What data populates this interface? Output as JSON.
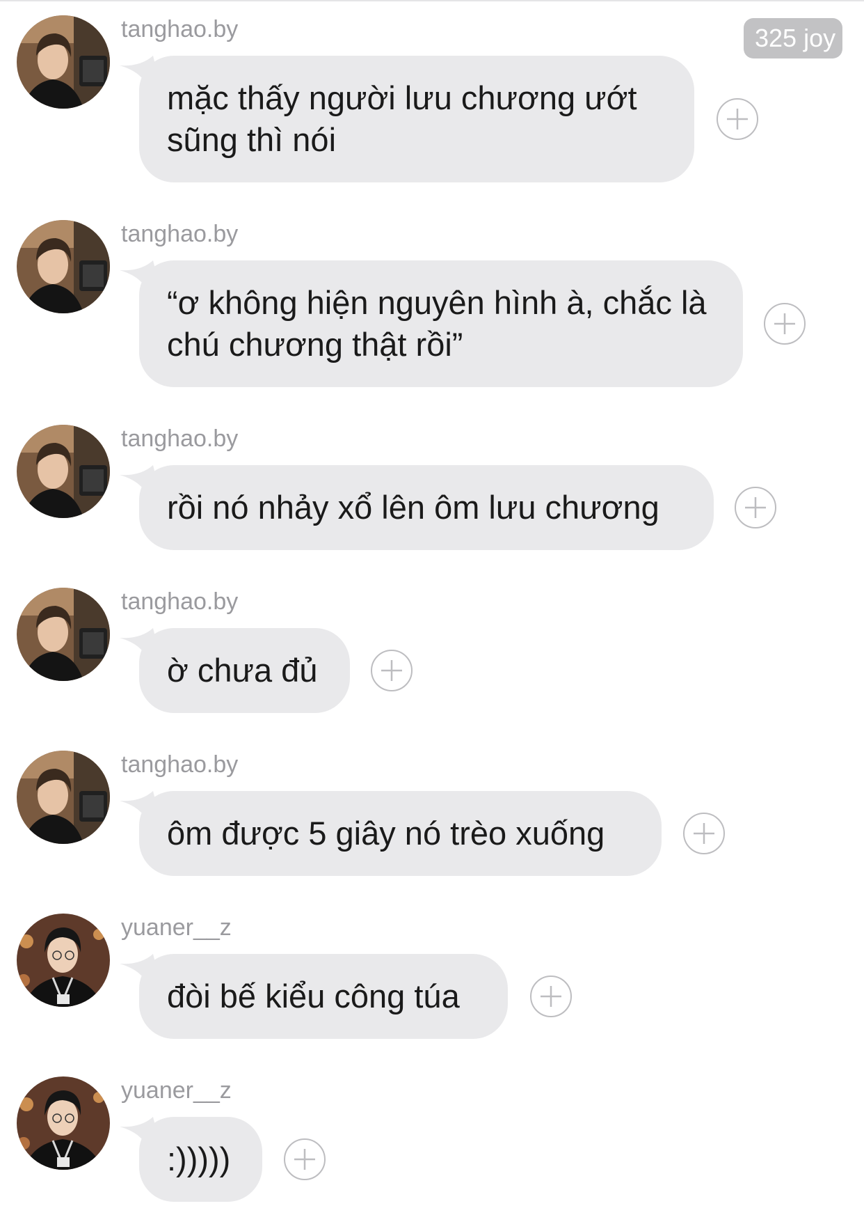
{
  "header": {
    "count_label": "325 joy"
  },
  "messages": [
    {
      "user": "tanghao.by",
      "avatar": "avatar-tanghao",
      "text": "mặc thấy người lưu chương ướt sũng thì nói"
    },
    {
      "user": "tanghao.by",
      "avatar": "avatar-tanghao",
      "text": "“ơ không hiện nguyên hình à, chắc là chú chương thật rồi”"
    },
    {
      "user": "tanghao.by",
      "avatar": "avatar-tanghao",
      "text": "rồi nó nhảy xổ lên ôm lưu chương"
    },
    {
      "user": "tanghao.by",
      "avatar": "avatar-tanghao",
      "text": "ờ chưa đủ"
    },
    {
      "user": "tanghao.by",
      "avatar": "avatar-tanghao",
      "text": "ôm được 5 giây nó trèo xuống"
    },
    {
      "user": "yuaner__z",
      "avatar": "avatar-yuaner",
      "text": "đòi bế kiểu công túa"
    },
    {
      "user": "yuaner__z",
      "avatar": "avatar-yuaner",
      "text": ":)))))"
    }
  ],
  "icons": {
    "add": "plus-circle-icon",
    "avatar_photo": "profile-photo"
  },
  "colors": {
    "bubble": "#e9e9eb",
    "username": "#9a9a9e",
    "badge": "#c2c2c4",
    "text": "#1a1a1a"
  }
}
